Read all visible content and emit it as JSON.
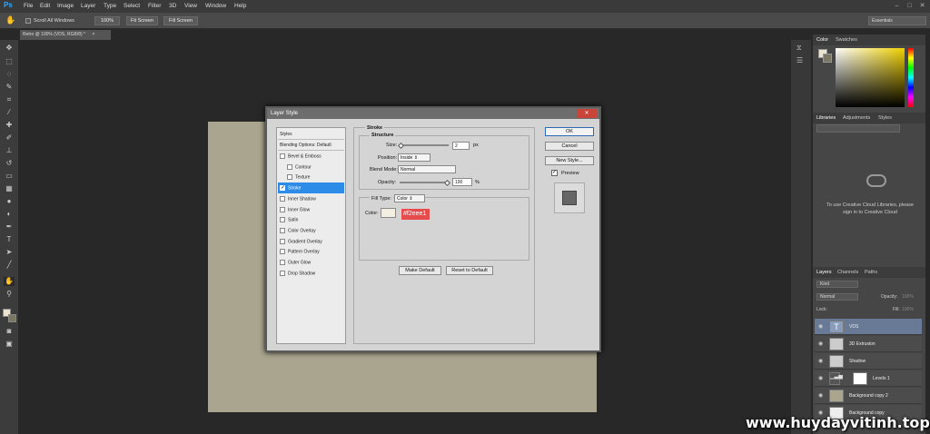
{
  "menubar": {
    "logo": "Ps",
    "items": [
      "File",
      "Edit",
      "Image",
      "Layer",
      "Type",
      "Select",
      "Filter",
      "3D",
      "View",
      "Window",
      "Help"
    ]
  },
  "optionsbar": {
    "scroll_all_windows": "Scroll All Windows",
    "btn_100": "100%",
    "btn_fit": "Fit Screen",
    "btn_fill": "Fill Screen",
    "workspace": "Essentials"
  },
  "document_tab": "Retro @ 100% (VDS, RGB/8) *",
  "dialog": {
    "title": "Layer Style",
    "styles_header": "Styles",
    "blending_options": "Blending Options: Default",
    "style_items": [
      {
        "label": "Bevel & Emboss",
        "checked": false
      },
      {
        "label": "Contour",
        "checked": false
      },
      {
        "label": "Texture",
        "checked": false
      },
      {
        "label": "Stroke",
        "checked": true
      },
      {
        "label": "Inner Shadow",
        "checked": false
      },
      {
        "label": "Inner Glow",
        "checked": false
      },
      {
        "label": "Satin",
        "checked": false
      },
      {
        "label": "Color Overlay",
        "checked": false
      },
      {
        "label": "Gradient Overlay",
        "checked": false
      },
      {
        "label": "Pattern Overlay",
        "checked": false
      },
      {
        "label": "Outer Glow",
        "checked": false
      },
      {
        "label": "Drop Shadow",
        "checked": false
      }
    ],
    "stroke_title": "Stroke",
    "structure_title": "Structure",
    "size_label": "Size:",
    "size_value": "2",
    "size_unit": "px",
    "position_label": "Position:",
    "position_value": "Inside",
    "blend_mode_label": "Blend Mode:",
    "blend_mode_value": "Normal",
    "opacity_label": "Opacity:",
    "opacity_value": "100",
    "opacity_unit": "%",
    "fill_type_label": "Fill Type:",
    "fill_type_value": "Color",
    "color_label": "Color:",
    "color_swatch": "#f2eee1",
    "hex_annotation": "#f2eee1",
    "make_default": "Make Default",
    "reset_default": "Reset to Default",
    "ok": "OK",
    "cancel": "Cancel",
    "new_style": "New Style...",
    "preview": "Preview"
  },
  "color_panel": {
    "tab_color": "Color",
    "tab_swatches": "Swatches"
  },
  "libraries_panel": {
    "tab_libraries": "Libraries",
    "tab_adjustments": "Adjustments",
    "tab_styles": "Styles",
    "message": "To use Creative Cloud Libraries, please sign in to Creative Cloud"
  },
  "layers_panel": {
    "tab_layers": "Layers",
    "tab_channels": "Channels",
    "tab_paths": "Paths",
    "kind": "Kind",
    "blend": "Normal",
    "opacity_label": "Opacity:",
    "opacity_value": "100%",
    "lock_label": "Lock:",
    "fill_label": "Fill:",
    "fill_value": "100%",
    "layers": [
      {
        "name": "VDS",
        "selected": true
      },
      {
        "name": "3D Extrusion",
        "selected": false
      },
      {
        "name": "Shadow",
        "selected": false
      },
      {
        "name": "Levels 1",
        "selected": false
      },
      {
        "name": "Background copy 2",
        "selected": false
      },
      {
        "name": "Background copy",
        "selected": false
      }
    ]
  },
  "watermark": "www.huydayvitinh.top"
}
